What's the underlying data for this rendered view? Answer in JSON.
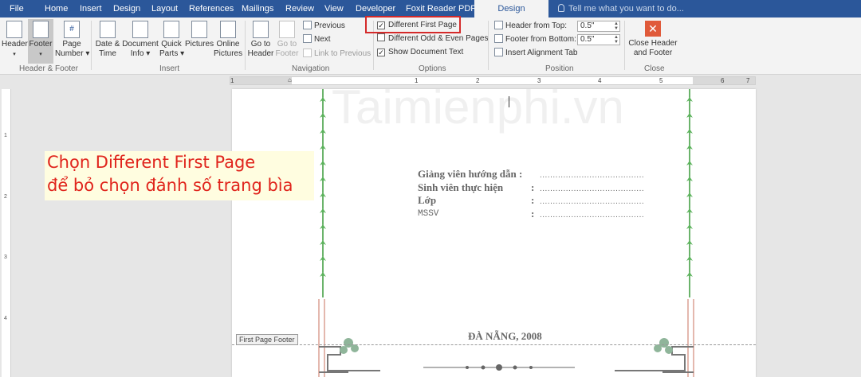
{
  "menubar": {
    "tabs": [
      "File",
      "Home",
      "Insert",
      "Design",
      "Layout",
      "References",
      "Mailings",
      "Review",
      "View",
      "Developer",
      "Foxit Reader PDF"
    ],
    "active_tab": "Design",
    "tell_me": "Tell me what you want to do..."
  },
  "ribbon": {
    "header_footer": {
      "header": "Header",
      "footer": "Footer",
      "page_number_1": "Page",
      "page_number_2": "Number",
      "label": "Header & Footer"
    },
    "insert": {
      "date_time_1": "Date &",
      "date_time_2": "Time",
      "doc_info_1": "Document",
      "doc_info_2": "Info",
      "quick_parts_1": "Quick",
      "quick_parts_2": "Parts",
      "pictures": "Pictures",
      "online_pictures_1": "Online",
      "online_pictures_2": "Pictures",
      "label": "Insert"
    },
    "navigation": {
      "goto_header_1": "Go to",
      "goto_header_2": "Header",
      "goto_footer_1": "Go to",
      "goto_footer_2": "Footer",
      "previous": "Previous",
      "next": "Next",
      "link_to_previous": "Link to Previous",
      "label": "Navigation"
    },
    "options": {
      "different_first_page": "Different First Page",
      "different_first_page_checked": true,
      "different_odd_even": "Different Odd & Even Pages",
      "different_odd_even_checked": false,
      "show_document_text": "Show Document Text",
      "show_document_text_checked": true,
      "label": "Options"
    },
    "position": {
      "header_from_top": "Header from Top:",
      "header_from_top_value": "0.5\"",
      "footer_from_bottom": "Footer from Bottom:",
      "footer_from_bottom_value": "0.5\"",
      "insert_alignment_tab": "Insert Alignment Tab",
      "label": "Position"
    },
    "close": {
      "close_1": "Close Header",
      "close_2": "and Footer",
      "label": "Close"
    }
  },
  "ruler": {
    "ticks": [
      "1",
      "1",
      "2",
      "3",
      "4",
      "5",
      "6",
      "7"
    ],
    "vticks": [
      "1",
      "2",
      "3",
      "4"
    ]
  },
  "document": {
    "watermark": "Taimienphi.vn",
    "rows": [
      {
        "label": "Giảng viên hướng dẫn :",
        "dots": "........................................"
      },
      {
        "label": "Sinh viên thực hiện",
        "colon": ":",
        "dots": "........................................"
      },
      {
        "label": "Lớp",
        "colon": ":",
        "dots": "........................................"
      },
      {
        "label": "MSSV",
        "colon": ":",
        "dots": "........................................"
      }
    ],
    "city_year": "ĐÀ NẴNG, 2008",
    "footer_tag": "First Page Footer"
  },
  "annotation": {
    "line1": "Chọn Different First Page",
    "line2": "để bỏ chọn đánh số trang bìa",
    "color": "#e0241c",
    "background": "#fffde0"
  },
  "colors": {
    "title_bar": "#2b579a",
    "ribbon_bg": "#f3f3f3",
    "highlight_box": "#d42a2a"
  }
}
